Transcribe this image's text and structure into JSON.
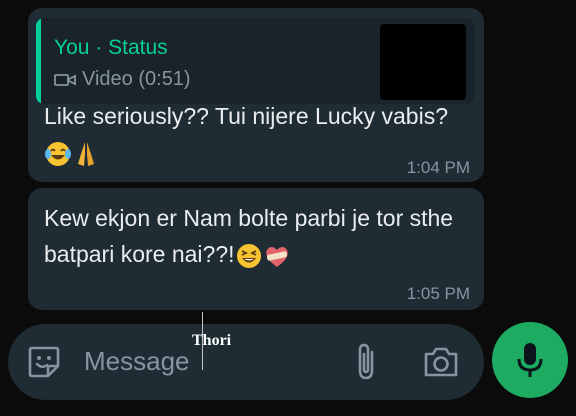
{
  "messages": [
    {
      "quote": {
        "author": "You · Status",
        "sub": "Video (0:51)"
      },
      "text": "Like seriously??  Tui nijere Lucky vabis?",
      "emojis": [
        "face-with-tears-of-joy",
        "folded-hands"
      ],
      "time": "1:04 PM"
    },
    {
      "text": "Kew ekjon er Nam bolte parbi je tor sthe batpari kore nai??!",
      "emojis": [
        "grinning-squinting-face",
        "mending-heart"
      ],
      "time": "1:05 PM"
    }
  ],
  "composer": {
    "placeholder": "Message"
  },
  "overlay": {
    "text": "Thori"
  },
  "colors": {
    "accent": "#06cf9c",
    "bubble": "#202c33",
    "mic": "#1daa61"
  }
}
